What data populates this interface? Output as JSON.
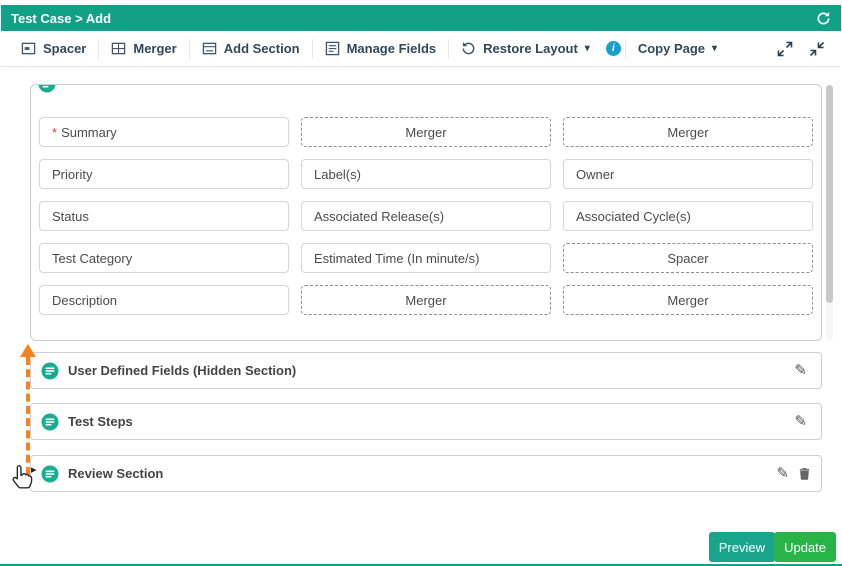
{
  "header": {
    "title": "Test Case > Add"
  },
  "toolbar": {
    "spacer": "Spacer",
    "merger": "Merger",
    "add_section": "Add Section",
    "manage_fields": "Manage Fields",
    "restore_layout": "Restore Layout",
    "copy_page": "Copy Page"
  },
  "icons": {
    "edit": "✎",
    "caret_down": "▾",
    "info": "i",
    "drag_caret": "▸",
    "required": "*"
  },
  "grid": {
    "rows": [
      [
        {
          "label": "Summary",
          "type": "field",
          "required": true
        },
        {
          "label": "Merger",
          "type": "merger"
        },
        {
          "label": "Merger",
          "type": "merger"
        }
      ],
      [
        {
          "label": "Priority",
          "type": "field"
        },
        {
          "label": "Label(s)",
          "type": "field"
        },
        {
          "label": "Owner",
          "type": "field"
        }
      ],
      [
        {
          "label": "Status",
          "type": "field"
        },
        {
          "label": "Associated Release(s)",
          "type": "field"
        },
        {
          "label": "Associated Cycle(s)",
          "type": "field"
        }
      ],
      [
        {
          "label": "Test Category",
          "type": "field"
        },
        {
          "label": "Estimated Time (In minute/s)",
          "type": "field"
        },
        {
          "label": "Spacer",
          "type": "spacer"
        }
      ],
      [
        {
          "label": "Description",
          "type": "field"
        },
        {
          "label": "Merger",
          "type": "merger"
        },
        {
          "label": "Merger",
          "type": "merger"
        }
      ]
    ]
  },
  "sections": [
    {
      "label": "User Defined Fields (Hidden Section)"
    },
    {
      "label": "Test Steps"
    },
    {
      "label": "Review Section"
    }
  ],
  "footer": {
    "preview": "Preview",
    "update": "Update"
  },
  "colors": {
    "teal": "#12a087",
    "section_icon_teal": "#16ad92",
    "orange": "#f58220",
    "update_green": "#28b446",
    "info_blue": "#18a1cc"
  }
}
